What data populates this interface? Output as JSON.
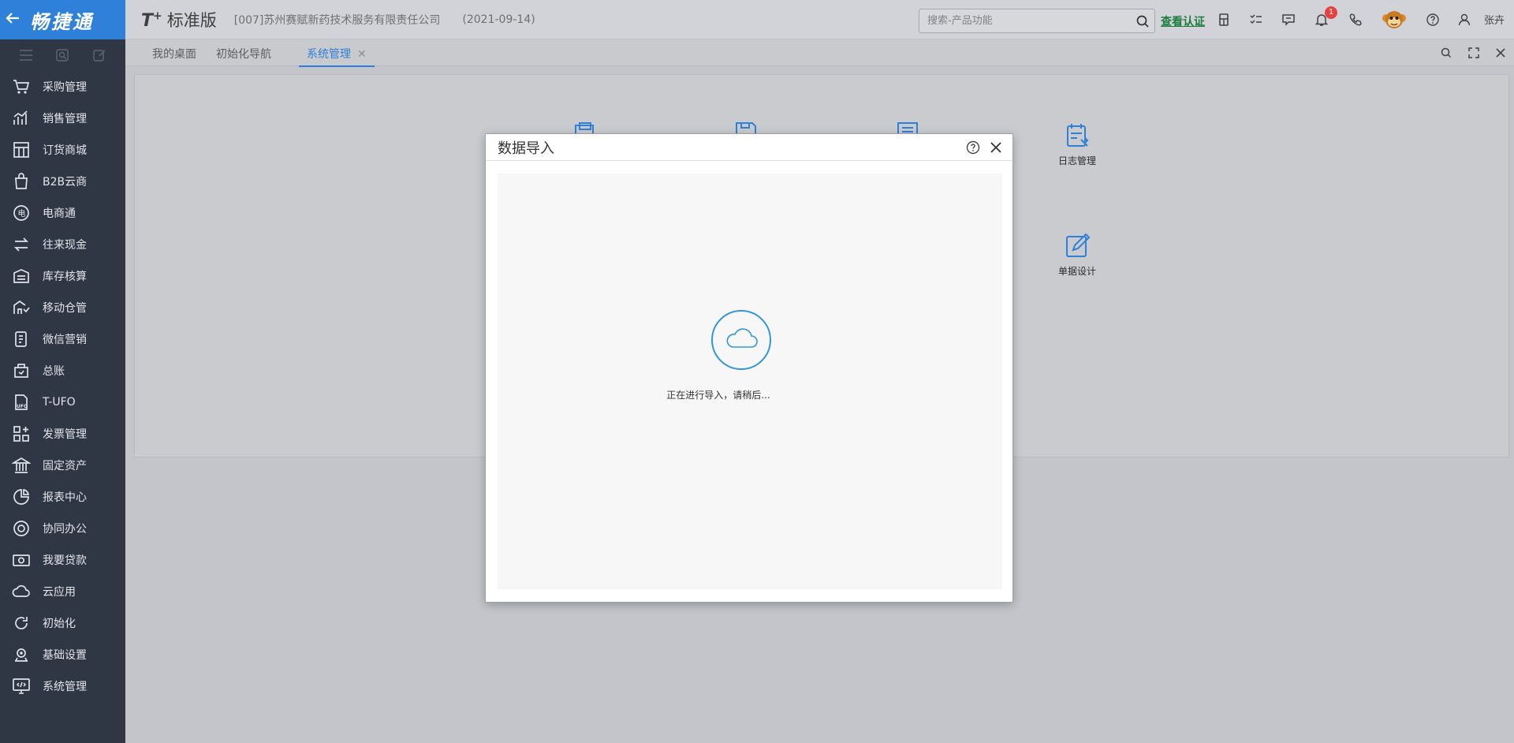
{
  "sidebar": {
    "brand": "畅捷通",
    "items": [
      {
        "label": "采购管理",
        "icon": "cart-icon"
      },
      {
        "label": "销售管理",
        "icon": "sales-chart-icon"
      },
      {
        "label": "订货商城",
        "icon": "store-icon"
      },
      {
        "label": "B2B云商",
        "icon": "bag-icon"
      },
      {
        "label": "电商通",
        "icon": "ecommerce-icon"
      },
      {
        "label": "往来现金",
        "icon": "transfer-icon"
      },
      {
        "label": "库存核算",
        "icon": "warehouse-icon"
      },
      {
        "label": "移动仓管",
        "icon": "mobile-warehouse-icon"
      },
      {
        "label": "微信营销",
        "icon": "wechat-marketing-icon"
      },
      {
        "label": "总账",
        "icon": "ledger-icon"
      },
      {
        "label": "T-UFO",
        "icon": "ufo-report-icon"
      },
      {
        "label": "发票管理",
        "icon": "invoice-icon"
      },
      {
        "label": "固定资产",
        "icon": "bank-icon"
      },
      {
        "label": "报表中心",
        "icon": "pie-chart-icon"
      },
      {
        "label": "协同办公",
        "icon": "collaboration-icon"
      },
      {
        "label": "我要贷款",
        "icon": "money-icon"
      },
      {
        "label": "云应用",
        "icon": "cloud-icon"
      },
      {
        "label": "初始化",
        "icon": "refresh-icon"
      },
      {
        "label": "基础设置",
        "icon": "settings-icon"
      },
      {
        "label": "系统管理",
        "icon": "system-icon"
      }
    ]
  },
  "header": {
    "product": "T",
    "product_plus": "+",
    "edition": "标准版",
    "company": "[007]苏州赛赋新药技术服务有限责任公司",
    "date": "(2021-09-14)",
    "search_placeholder": "搜索-产品功能",
    "verify_label": "查看认证",
    "notification_count": "1",
    "user_name": "张卉"
  },
  "tabs": [
    {
      "label": "我的桌面"
    },
    {
      "label": "初始化导航"
    },
    {
      "label": "系统管理",
      "active": true
    }
  ],
  "features": [
    {
      "label": "日志管理",
      "icon": "log-manage-icon"
    },
    {
      "label": "单据设计",
      "icon": "form-design-icon"
    }
  ],
  "modal": {
    "title": "数据导入",
    "loading_text": "正在进行导入，请稍后..."
  },
  "colors": {
    "accent": "#2f80d8",
    "sidebar_bg": "#2f3744",
    "badge": "#e64340",
    "verify_link": "#1d7d3d"
  }
}
